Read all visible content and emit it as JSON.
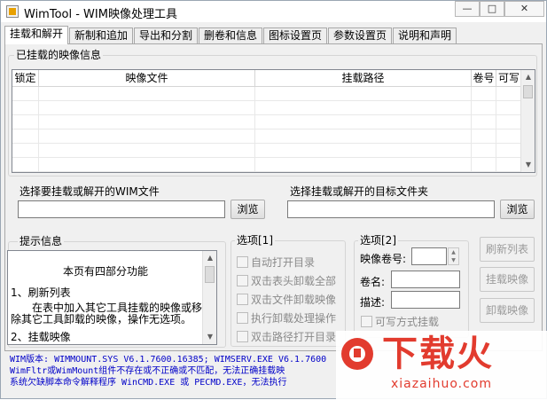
{
  "window": {
    "title": "WimTool - WIM映像处理工具",
    "min_glyph": "—",
    "max_glyph": "□",
    "close_glyph": "✕"
  },
  "tabs": [
    {
      "label": "挂载和解开",
      "active": true
    },
    {
      "label": "新制和追加",
      "active": false
    },
    {
      "label": "导出和分割",
      "active": false
    },
    {
      "label": "删卷和信息",
      "active": false
    },
    {
      "label": "图标设置页",
      "active": false
    },
    {
      "label": "参数设置页",
      "active": false
    },
    {
      "label": "说明和声明",
      "active": false
    }
  ],
  "mounted": {
    "group_label": "已挂载的映像信息",
    "columns": [
      "锁定",
      "映像文件",
      "挂载路径",
      "卷号",
      "可写"
    ]
  },
  "select_wim": {
    "label": "选择要挂载或解开的WIM文件",
    "value": "",
    "browse": "浏览"
  },
  "select_target": {
    "label": "选择挂载或解开的目标文件夹",
    "value": "",
    "browse": "浏览"
  },
  "hint": {
    "label": "提示信息",
    "title": "本页有四部分功能",
    "item1": "1、刷新列表",
    "desc1": "在表中加入其它工具挂载的映像或移除其它工具卸载的映像，操作无选项。",
    "item2": "2、挂载映像"
  },
  "options1": {
    "label": "选项[1]",
    "items": [
      "自动打开目录",
      "双击表头卸载全部",
      "双击文件卸载映像",
      "执行卸载处理操作",
      "双击路径打开目录"
    ]
  },
  "options2": {
    "label": "选项[2]",
    "volume_label": "映像卷号:",
    "volume_value": "",
    "name_label": "卷名:",
    "name_value": "",
    "desc_label": "描述:",
    "desc_value": "",
    "writable_label": "可写方式挂载"
  },
  "actions": {
    "refresh": "刷新列表",
    "mount": "挂载映像",
    "unmount": "卸载映像"
  },
  "status_lines": [
    "WIM版本: WIMMOUNT.SYS V6.1.7600.16385; WIMSERV.EXE V6.1.7600",
    "WimFltr或WimMount组件不存在或不正确或不匹配，无法正确挂载映",
    "系统欠缺脚本命令解释程序 WinCMD.EXE 或 PECMD.EXE，无法执行"
  ],
  "watermark": {
    "text": "下载火",
    "domain": "xiazaihuo.com"
  }
}
